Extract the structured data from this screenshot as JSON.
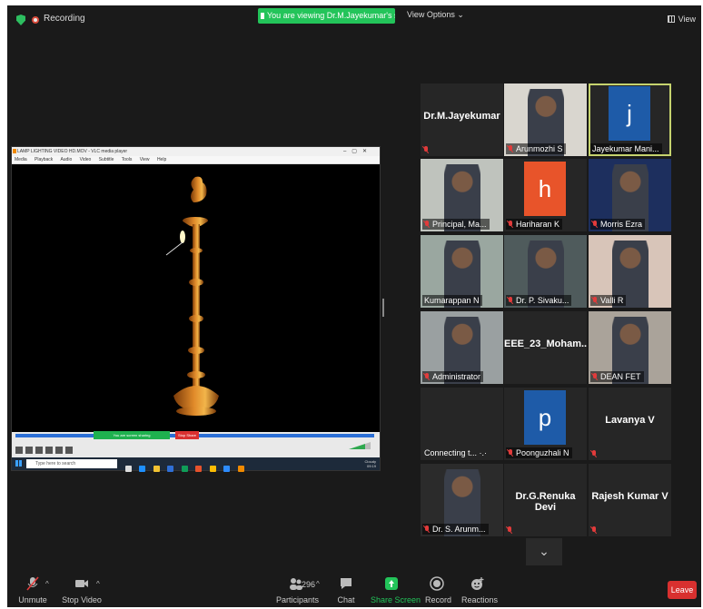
{
  "topbar": {
    "recording_label": "Recording",
    "viewing_banner": "You are viewing Dr.M.Jayekumar's screen",
    "view_options": "View Options",
    "view_label": "View"
  },
  "shared_screen": {
    "vlc_title": "LAMP LIGHTING VIDEO HD.MOV - VLC media player",
    "vlc_menu": [
      "Media",
      "Playback",
      "Audio",
      "Video",
      "Subtitle",
      "Tools",
      "View",
      "Help"
    ],
    "mini_banner": "You are screen sharing",
    "mini_stop": "Stop Share",
    "taskbar_search": "Type here to search",
    "tray_line1": "Cloudy",
    "tray_line2": "09:19"
  },
  "participants": [
    {
      "name": "Dr.M.Jayekumar",
      "style": "name-only",
      "muted": true
    },
    {
      "name": "Arunmozhi S",
      "style": "video",
      "muted": true
    },
    {
      "name": "Jayekumar Mani...",
      "style": "avatar",
      "letter": "j",
      "color": "#1e5ba8",
      "muted": false,
      "active": true
    },
    {
      "name": "Principal, Ma...",
      "style": "video",
      "muted": true
    },
    {
      "name": "Hariharan K",
      "style": "avatar",
      "letter": "h",
      "color": "#e8542a",
      "muted": true
    },
    {
      "name": "Morris Ezra",
      "style": "video",
      "muted": true
    },
    {
      "name": "Kumarappan N",
      "style": "video",
      "muted": false
    },
    {
      "name": "Dr. P. Sivaku...",
      "style": "video",
      "muted": true
    },
    {
      "name": "Valli R",
      "style": "video",
      "muted": true
    },
    {
      "name": "Administrator",
      "style": "video",
      "muted": true
    },
    {
      "name": "EEE_23_Moham...",
      "style": "name-only",
      "muted": false
    },
    {
      "name": "DEAN FET",
      "style": "video",
      "muted": true
    },
    {
      "name": "Connecting t...",
      "style": "connecting",
      "muted": false
    },
    {
      "name": "Poonguzhali N",
      "style": "avatar",
      "letter": "p",
      "color": "#1e5ba8",
      "muted": true
    },
    {
      "name": "Lavanya V",
      "style": "name-only",
      "muted": true
    },
    {
      "name": "Dr. S. Arunm...",
      "style": "video",
      "muted": true
    },
    {
      "name": "Dr.G.Renuka Devi",
      "style": "name-only",
      "muted": true
    },
    {
      "name": "Rajesh Kumar V",
      "style": "name-only",
      "muted": true
    }
  ],
  "toolbar": {
    "unmute": "Unmute",
    "stop_video": "Stop Video",
    "participants": "Participants",
    "participant_count": "296",
    "chat": "Chat",
    "share_screen": "Share Screen",
    "record": "Record",
    "reactions": "Reactions",
    "leave": "Leave"
  },
  "colors": {
    "accent_green": "#23c45a",
    "leave_red": "#d8302f",
    "active_border": "#c6d36e"
  }
}
